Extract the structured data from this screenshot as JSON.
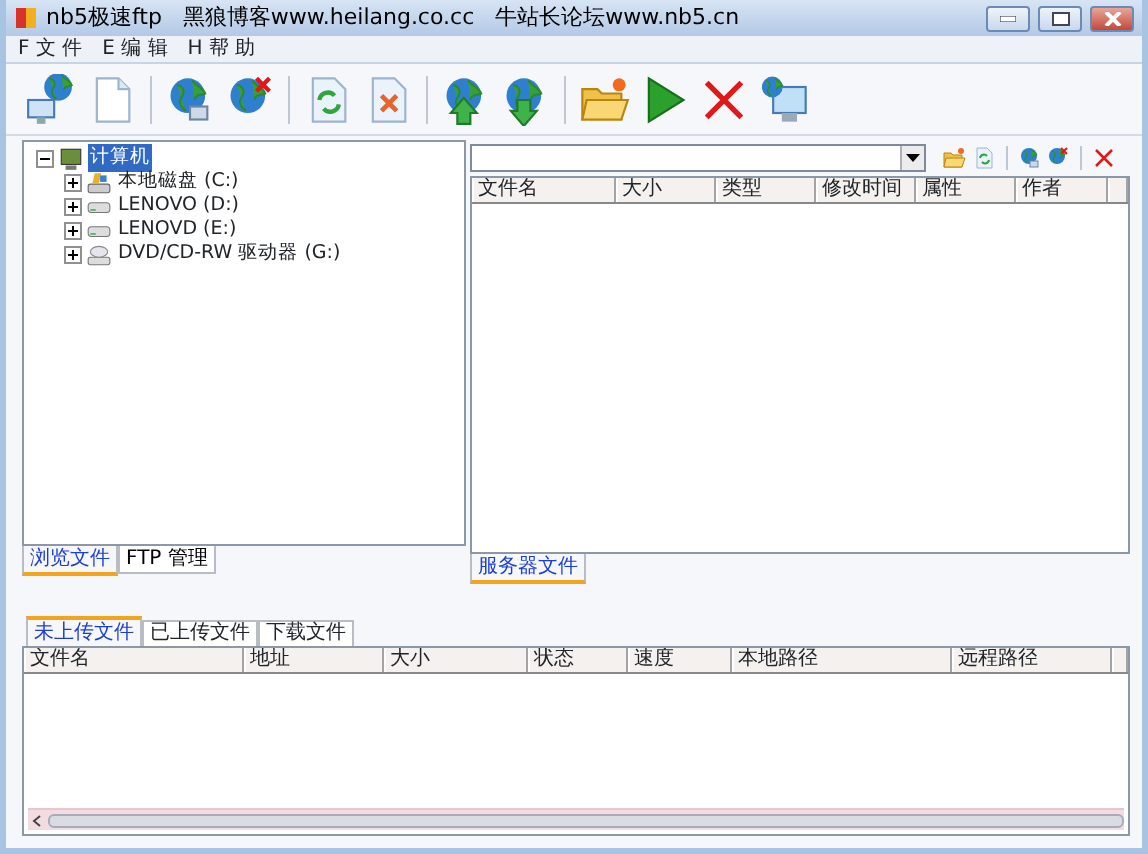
{
  "window": {
    "title": "nb5极速ftp   黑狼博客www.heilang.co.cc   牛站长论坛www.nb5.cn"
  },
  "menu": [
    "F 文 件",
    "E 编 辑",
    "H 帮 助"
  ],
  "toolbar": [
    {
      "kind": "connect"
    },
    {
      "kind": "page"
    },
    {
      "kind": "sep"
    },
    {
      "kind": "globe"
    },
    {
      "kind": "globe-x"
    },
    {
      "kind": "sep"
    },
    {
      "kind": "refresh"
    },
    {
      "kind": "delete"
    },
    {
      "kind": "sep"
    },
    {
      "kind": "up"
    },
    {
      "kind": "down"
    },
    {
      "kind": "sep"
    },
    {
      "kind": "folder"
    },
    {
      "kind": "play"
    },
    {
      "kind": "cross"
    },
    {
      "kind": "monitor"
    }
  ],
  "local_tree": [
    {
      "label": "计算机",
      "kind": "computer",
      "selected": true,
      "expanded": true,
      "children": [
        {
          "label": "本地磁盘 (C:)",
          "kind": "disk",
          "selected": false,
          "expanded": false
        },
        {
          "label": "LENOVO (D:)",
          "kind": "drive",
          "selected": false,
          "expanded": false
        },
        {
          "label": "LENOVD (E:)",
          "kind": "drive",
          "selected": false,
          "expanded": false
        },
        {
          "label": "DVD/CD-RW 驱动器 (G:)",
          "kind": "cdrom",
          "selected": false,
          "expanded": false
        }
      ]
    }
  ],
  "local_tabs": [
    {
      "label": "浏览文件",
      "selected": true
    },
    {
      "label": "FTP 管理",
      "selected": false
    }
  ],
  "server_tools": [
    {
      "kind": "folder"
    },
    {
      "kind": "refresh"
    },
    {
      "kind": "sep"
    },
    {
      "kind": "globe"
    },
    {
      "kind": "globe-x"
    },
    {
      "kind": "sep"
    },
    {
      "kind": "cross"
    }
  ],
  "server_columns": [
    "文件名",
    "大小",
    "类型",
    "修改时间",
    "属性",
    "作者"
  ],
  "server_tabs": [
    {
      "label": "服务器文件",
      "selected": true
    }
  ],
  "queue_tabs": [
    {
      "label": "未上传文件",
      "selected": true
    },
    {
      "label": "已上传文件",
      "selected": false
    },
    {
      "label": "下载文件",
      "selected": false
    }
  ],
  "queue_columns": [
    "文件名",
    "地址",
    "大小",
    "状态",
    "速度",
    "本地路径",
    "远程路径"
  ]
}
